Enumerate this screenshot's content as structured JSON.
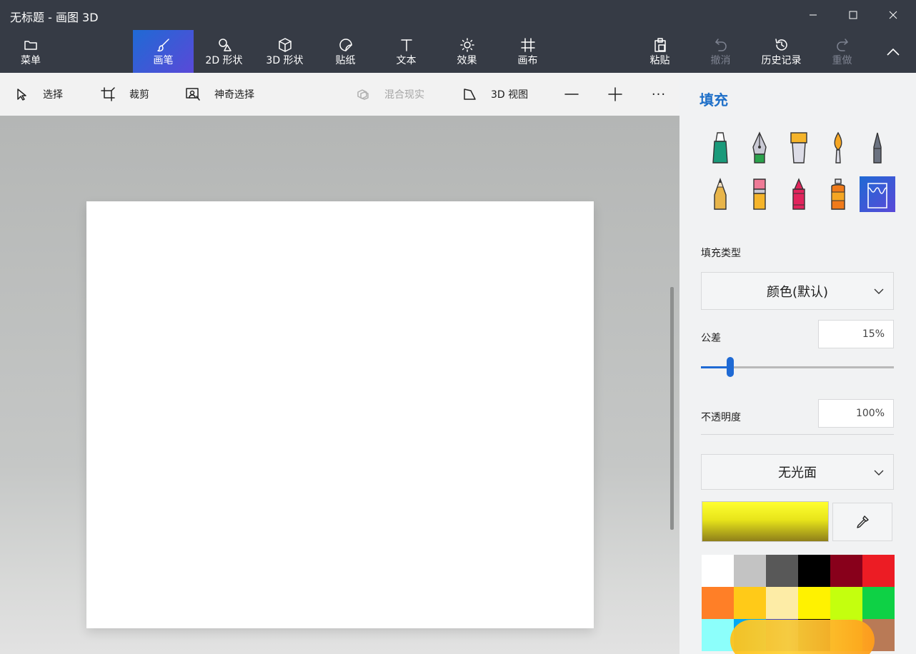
{
  "window": {
    "title": "无标题 - 画图 3D"
  },
  "ribbon": {
    "menu_label": "菜单",
    "tabs": [
      {
        "label": "画笔",
        "icon": "brush-icon",
        "active": true
      },
      {
        "label": "2D 形状",
        "icon": "2d-shapes-icon"
      },
      {
        "label": "3D 形状",
        "icon": "3d-shapes-icon"
      },
      {
        "label": "贴纸",
        "icon": "sticker-icon"
      },
      {
        "label": "文本",
        "icon": "text-icon"
      },
      {
        "label": "效果",
        "icon": "effects-sun-icon"
      },
      {
        "label": "画布",
        "icon": "canvas-grid-icon"
      }
    ],
    "actions": [
      {
        "label": "粘贴",
        "icon": "paste-icon",
        "enabled": true
      },
      {
        "label": "撤消",
        "icon": "undo-icon",
        "enabled": false
      },
      {
        "label": "历史记录",
        "icon": "history-icon",
        "enabled": true
      },
      {
        "label": "重做",
        "icon": "redo-icon",
        "enabled": false
      }
    ]
  },
  "toolbar": {
    "select": "选择",
    "crop": "裁剪",
    "magic_select": "神奇选择",
    "mixed_reality": "混合现实",
    "view_3d": "3D 视图",
    "more": "···"
  },
  "panel": {
    "title": "填充",
    "brushes": [
      {
        "name": "marker",
        "color": "#1a9a7a"
      },
      {
        "name": "calligraphy-pen",
        "color": "#2ba24c"
      },
      {
        "name": "oil-brush",
        "color": "#f5b42a"
      },
      {
        "name": "watercolor",
        "color": "#f5a623"
      },
      {
        "name": "pixel-pen",
        "color": "#6b7280"
      },
      {
        "name": "pencil",
        "color": "#e8b54a"
      },
      {
        "name": "eraser",
        "color": "#ee7a96"
      },
      {
        "name": "crayon",
        "color": "#e1245c"
      },
      {
        "name": "spray-can",
        "color": "#f07a1a"
      },
      {
        "name": "fill",
        "color": "#1f6ad4",
        "active": true
      }
    ],
    "fill_type_label": "填充类型",
    "fill_type_value": "颜色(默认)",
    "tolerance_label": "公差",
    "tolerance_value": "15%",
    "tolerance": 0.15,
    "opacity_label": "不透明度",
    "opacity_value": "100%",
    "finish_value": "无光面",
    "current_color": "#ffff30",
    "palette": [
      "#ffffff",
      "#c3c3c3",
      "#585858",
      "#000000",
      "#88001b",
      "#ec1c24",
      "#ff7f27",
      "#ffca18",
      "#fdeca6",
      "#fff200",
      "#c4ff0e",
      "#0ed145",
      "#8cfffb",
      "#00a8f3",
      "#3f48cc",
      "#000000",
      "#c4ff0e",
      "#b97a56"
    ]
  }
}
